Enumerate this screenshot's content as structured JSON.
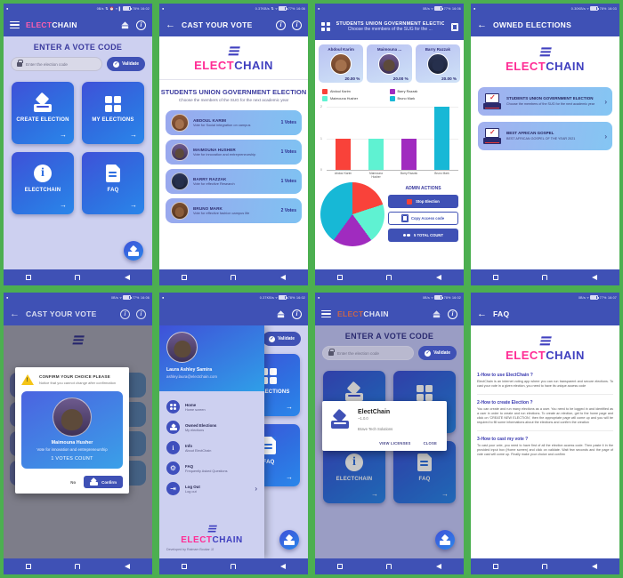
{
  "brand": {
    "name_a": "ELECT",
    "name_b": "CHAIN",
    "mark": "≡",
    "accent_pink": "#ff2d95",
    "accent_indigo": "#3f3fbf",
    "primary": "#3f51b5"
  },
  "status_bars": [
    {
      "speed": "0B/s",
      "battery": "78%",
      "time": "16:02"
    },
    {
      "speed": "0.37KB/s",
      "battery": "77%",
      "time": "16:06"
    },
    {
      "speed": "0B/s",
      "battery": "77%",
      "time": "16:06"
    },
    {
      "speed": "0.30KB/s",
      "battery": "78%",
      "time": "16:03"
    },
    {
      "speed": "0B/s",
      "battery": "77%",
      "time": "16:06"
    },
    {
      "speed": "0.37KB/s",
      "battery": "78%",
      "time": "16:02"
    },
    {
      "speed": "0B/s",
      "battery": "78%",
      "time": "16:02"
    },
    {
      "speed": "0B/s",
      "battery": "77%",
      "time": "16:07"
    }
  ],
  "screen1_home": {
    "appbar_title_a": "ELECT",
    "appbar_title_b": "CHAIN",
    "heading": "ENTER A VOTE CODE",
    "code_placeholder": "Enter the election code",
    "validate_label": "Validate",
    "tiles": [
      {
        "label": "CREATE ELECTION",
        "icon": "ballot-box-icon",
        "arrow": "→"
      },
      {
        "label": "MY ELECTIONS",
        "icon": "grid-icon",
        "arrow": "→"
      },
      {
        "label": "ELECTCHAIN",
        "icon": "info-icon",
        "arrow": "→"
      },
      {
        "label": "FAQ",
        "icon": "document-icon",
        "arrow": "→"
      }
    ]
  },
  "screen2_cast_vote": {
    "appbar_title": "CAST YOUR VOTE",
    "election_title": "STUDENTS UNION GOVERNMENT ELECTION",
    "election_sub": "Choose the members of the SUG for the next academic year",
    "candidates": [
      {
        "name": "ABDOUL KARIM",
        "desc": "Vote for Social integration on campus",
        "votes": "1 Votes"
      },
      {
        "name": "MAIMOUNA HUSHER",
        "desc": "Vote for innovation and entrepreneurship",
        "votes": "1 Votes"
      },
      {
        "name": "BARRY RAZZAK",
        "desc": "Vote for effective Research",
        "votes": "1 Votes"
      },
      {
        "name": "BRUNO MARK",
        "desc": "Vote for effective fashion campus life",
        "votes": "2 Votes"
      }
    ]
  },
  "screen3_results": {
    "appbar_title": "STUDENTS UNION GOVERNMENT ELECTION",
    "appbar_sub": "Choose the members of the SUG for the ...",
    "percent_cards": [
      {
        "name": "Abdoul Karim",
        "percent": "20.00 %"
      },
      {
        "name": "Maimouna ...",
        "percent": "20.00 %"
      },
      {
        "name": "Barry Razzak",
        "percent": "20.00 %"
      }
    ],
    "admin_title": "ADMIN ACTIONS",
    "actions": [
      {
        "label": "Stop Election",
        "icon": "stop-square-icon"
      },
      {
        "label": "Copy Access code",
        "icon": "copy-icon"
      },
      {
        "label": "5 TOTAL COUNT",
        "icon": "people-icon"
      }
    ]
  },
  "chart_data": [
    {
      "type": "bar",
      "title": "",
      "categories": [
        "Abdoul Karim",
        "Maimouna Husher",
        "Barry Razzak",
        "Bruno Mark"
      ],
      "values": [
        1,
        1,
        1,
        2
      ],
      "colors": [
        "#f9423a",
        "#5ff2d2",
        "#a02bbf",
        "#17b8d6"
      ],
      "xlabel": "",
      "ylabel": "",
      "ylim": [
        0,
        2
      ],
      "yticks": [
        "0",
        "1",
        "2"
      ],
      "grid": true,
      "legend": [
        {
          "label": "Abdoul Karim",
          "color": "#f9423a"
        },
        {
          "label": "Barry Razzak",
          "color": "#a02bbf"
        },
        {
          "label": "Maimouna Husher",
          "color": "#5ff2d2"
        },
        {
          "label": "Bruno Mark",
          "color": "#17b8d6"
        }
      ],
      "legend_position": "top"
    },
    {
      "type": "pie",
      "title": "",
      "categories": [
        "Abdoul Karim",
        "Maimouna Husher",
        "Barry Razzak",
        "Bruno Mark"
      ],
      "values": [
        1,
        1,
        1,
        2
      ],
      "colors": [
        "#f9423a",
        "#5ff2d2",
        "#a02bbf",
        "#17b8d6"
      ],
      "legend_position": "none"
    }
  ],
  "screen4_owned": {
    "appbar_title": "OWNED ELECTIONS",
    "items": [
      {
        "name": "STUDENTS UNION GOVERNMENT ELECTION",
        "desc": "Choose the members of the SUG for the next academic year",
        "chevron": "›"
      },
      {
        "name": "BEST AFRICAN GOSPEL",
        "desc": "BEST AFRICAN GOSPEL OF THE YEAR 2021",
        "chevron": "›"
      }
    ]
  },
  "screen5_confirm": {
    "appbar_title": "CAST YOUR VOTE",
    "dialog_title": "CONFIRM YOUR CHOICE PLEASE",
    "dialog_sub": "Notice that you cannot change after confirmation",
    "choice_name": "Maimouna Husher",
    "choice_desc": "Vote for innovation and entrepreneurship",
    "choice_count": "1 VOTES COUNT",
    "no_label": "No",
    "confirm_label": "Confirm"
  },
  "screen6_drawer": {
    "user_name": "Laura Ashley Samira",
    "user_email": "ashley.laura@electchain.com",
    "menu": [
      {
        "label": "Home",
        "sub": "Home screen",
        "icon": "grid-icon"
      },
      {
        "label": "Owned Elections",
        "sub": "My elections",
        "icon": "ballot-box-icon"
      },
      {
        "label": "Info",
        "sub": "About ElectChain",
        "icon": "info-icon"
      },
      {
        "label": "FAQ",
        "sub": "Frequently Asked Questions",
        "icon": "gear-icon"
      },
      {
        "label": "Log Out",
        "sub": "Log out",
        "icon": "logout-icon",
        "chevron": "›"
      }
    ],
    "dev_credit": "Developed by Raimam Boukar JJ"
  },
  "screen7_about": {
    "heading": "ENTER A VOTE CODE",
    "code_placeholder": "Enter the election code",
    "validate_label": "Validate",
    "app_name": "ElectChain",
    "app_version": "~1.0.0",
    "company": "Brave Tech Solutions",
    "view_licenses": "VIEW LICENSES",
    "close": "CLOSE"
  },
  "screen8_faq": {
    "appbar_title": "FAQ",
    "items": [
      {
        "q": "1-How to use ElectChain ?",
        "a": "ElectChain is an internet voting app where you can run transparent and secure elections. To cast your vote in a given election, you need to have its unique access code"
      },
      {
        "q": "2-How to create Election ?",
        "a": "You can create and run many elections as a user. You need to be logged in and identified as a user in order to create and run elections. To create an election, get to the home page and click on 'CREATE NEW ELECTION', then the appropriate page will come up and you will be required to fill some informations about the elections and confirm the creation"
      },
      {
        "q": "3-How to cast my vote ?",
        "a": "To cast your vote, you need to have first of all the election access code. Then paste it in the provided input box (Home screen) and click on validate. Wait few seconds and the page of vote cast will come up. Finally make your choice and confirm"
      }
    ]
  },
  "navbar": {
    "recent": "recent-apps-icon",
    "home": "home-icon",
    "back": "back-icon"
  }
}
